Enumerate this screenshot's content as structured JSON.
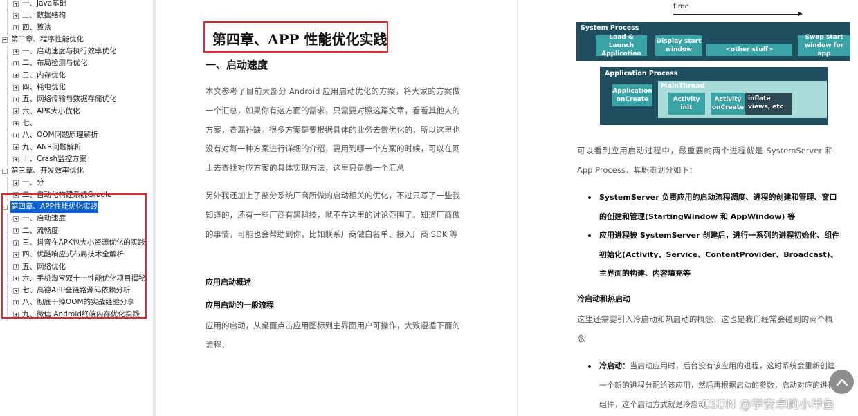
{
  "sidebar": {
    "items": [
      {
        "level": 1,
        "toggle": "plus",
        "label": "一、Java基础"
      },
      {
        "level": 1,
        "toggle": "plus",
        "label": "三、数据结构"
      },
      {
        "level": 1,
        "toggle": "plus",
        "label": "四、算法"
      },
      {
        "level": 0,
        "toggle": "minus",
        "label": "第二章、程序性能优化"
      },
      {
        "level": 1,
        "toggle": "plus",
        "label": "一、启动速度与执行效率优化"
      },
      {
        "level": 1,
        "toggle": "plus",
        "label": "二、布局检测与优化"
      },
      {
        "level": 1,
        "toggle": "plus",
        "label": "三、内存优化"
      },
      {
        "level": 1,
        "toggle": "plus",
        "label": "四、耗电优化"
      },
      {
        "level": 1,
        "toggle": "plus",
        "label": "五、网络传输与数据存储优化"
      },
      {
        "level": 1,
        "toggle": "plus",
        "label": "六、APK大小优化"
      },
      {
        "level": 1,
        "toggle": "plus",
        "label": "七、"
      },
      {
        "level": 1,
        "toggle": "plus",
        "label": "八、OOM问题原理解析"
      },
      {
        "level": 1,
        "toggle": "plus",
        "label": "九、ANR问题解析"
      },
      {
        "level": 1,
        "toggle": "plus",
        "label": "十、Crash监控方案"
      },
      {
        "level": 0,
        "toggle": "minus",
        "label": "第三章、开发效率优化"
      },
      {
        "level": 1,
        "toggle": "plus",
        "label": "一、分"
      },
      {
        "level": 1,
        "toggle": "plus",
        "label": "二、自动化构建系统Gradle"
      },
      {
        "level": 0,
        "toggle": "minus",
        "label": "第四章、APP性能优化实践",
        "selected": true
      },
      {
        "level": 1,
        "toggle": "plus",
        "label": "一、启动速度"
      },
      {
        "level": 1,
        "toggle": "plus",
        "label": "二、流畅度"
      },
      {
        "level": 1,
        "toggle": "plus",
        "label": "三、抖音在APK包大小资源优化的实践"
      },
      {
        "level": 1,
        "toggle": "plus",
        "label": "四、优酷响应式布局技术全解析"
      },
      {
        "level": 1,
        "toggle": "plus",
        "label": "五、网络优化"
      },
      {
        "level": 1,
        "toggle": "plus",
        "label": "六、手机淘宝双十一性能优化项目揭秘"
      },
      {
        "level": 1,
        "toggle": "plus",
        "label": "七、高德APP全链路源码依赖分析"
      },
      {
        "level": 1,
        "toggle": "plus",
        "label": "八、彻底干掉OOM的实战经验分享"
      },
      {
        "level": 1,
        "toggle": "plus",
        "label": "九、微信 Android终端内存优化实践"
      }
    ]
  },
  "left_page": {
    "chapter_title": "第四章、APP 性能优化实践",
    "section_title": "一、启动速度",
    "para1": "本文参考了目前大部分 Android 应用启动优化的方案，将大家的方案做一个汇总，如果你有这方面的需求，只需要对照这篇文章，看看其他人的方案，查漏补缺。很多方案是要根据具体的业务去做优化的，所以这里也没有对每一种方案进行详细的介绍，要用到哪一个方案的时候，可以在网上去查找对应方案的具体实现方法，这里只是做一个汇总",
    "para2": "另外我还加上了部分系统厂商所做的启动相关的优化，不过只写了一些我知道的，还有一些厂商有黑科技，就不在这里的讨论范围了。知道厂商做的事情，可能也会帮助到你，比如联系厂商做白名单、接入厂商 SDK 等",
    "sub1": "应用启动概述",
    "sub2": "应用启动的一般流程",
    "para3": "应用的启动，从桌面点击应用图标到主界面用户可操作，大致遵循下面的流程："
  },
  "diagram": {
    "time_label": "time",
    "system_process": "System Process",
    "sys_boxes": [
      "Load & Launch Application",
      "Display start window",
      "<other stuff>",
      "Swap start window for app"
    ],
    "application_process": "Application Process",
    "app_on_create": "Application onCreate",
    "main_thread": "MainThread",
    "activity_init": "Activity init",
    "activity_on_create": "Activity onCreate",
    "inflate_views": "inflate views, etc",
    "colors": {
      "band": "#1f4f5e",
      "teal": "#3aa3a5",
      "main_thread": "#a7dcd8",
      "dark": "#2e4854"
    }
  },
  "right_page": {
    "para1": "可以看到应用启动过程中，最重要的两个进程就是 SystemServer 和 App Process．其职责划分如下：",
    "bullets1": [
      "SystemServer 负责应用的启动流程调度、进程的创建和管理、窗口的创建和管理(StartingWindow 和 AppWindow) 等",
      "应用进程被 SystemServer 创建后，进行一系列的进程初始化、组件初始化(Activity、Service、ContentProvider、Broadcast)、主界面的构建、内容填充等"
    ],
    "sub1": "冷启动和热启动",
    "para2": "这里还需要引入冷启动和热启动的概念，这也是我们经常会碰到的两个概念",
    "cold_label": "冷启动：",
    "cold_text": "当启动应用时，后台没有该应用的进程，这时系统会重新创建一个新的进程分配给该应用，然后再根据启动的参数，启动对应的进程组件，这个启动方式就是冷启动"
  },
  "widgets": {
    "scroll_top_icon": "chevron-up-icon",
    "watermark": "CSDN @学安卓的小甲鱼"
  },
  "accent_colors": {
    "highlight_red": "#e0292f",
    "selection_blue": "#0a62d4"
  }
}
